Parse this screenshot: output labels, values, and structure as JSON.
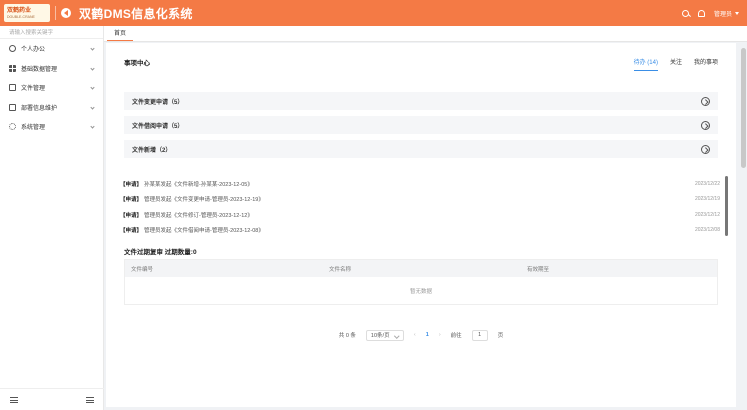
{
  "header": {
    "logo_line1": "双鹤药业",
    "logo_line2": "DOUBLE-CRANE",
    "title": "双鹤DMS信息化系统",
    "user": "管理员"
  },
  "sidebar": {
    "search_placeholder": "请输入搜索关键字",
    "items": [
      {
        "label": "个人办公",
        "icon": "person-icon"
      },
      {
        "label": "基础数据管理",
        "icon": "grid-icon"
      },
      {
        "label": "文件管理",
        "icon": "file-icon"
      },
      {
        "label": "部署信息维护",
        "icon": "doc-icon"
      },
      {
        "label": "系统管理",
        "icon": "gear-icon"
      }
    ]
  },
  "tabs": [
    "首页"
  ],
  "todo": {
    "title": "事项中心",
    "subtabs": [
      "待办 (14)",
      "关注",
      "我的事项"
    ],
    "groups": [
      {
        "label": "文件变更申请（5）"
      },
      {
        "label": "文件借阅申请（5）"
      },
      {
        "label": "文件新增（2）"
      }
    ],
    "messages": [
      {
        "tag": "【申请】",
        "text": "孙某某发起《文件新增-孙某某-2023-12-05》",
        "date": "2023/12/22"
      },
      {
        "tag": "【申请】",
        "text": "管理员发起《文件变更申请-管理员-2023-12-19》",
        "date": "2023/12/19"
      },
      {
        "tag": "【申请】",
        "text": "管理员发起《文件修订-管理员-2023-12-12》",
        "date": "2023/12/12"
      },
      {
        "tag": "【申请】",
        "text": "管理员发起《文件借阅申请-管理员-2023-12-08》",
        "date": "2023/12/08"
      }
    ]
  },
  "expire": {
    "title": "文件过期复审 过期数量:0",
    "columns": [
      "文件编号",
      "文件名称",
      "有效期至"
    ],
    "empty_text": "暂无数据"
  },
  "pager": {
    "total": "共 0 条",
    "page_size": "10条/页",
    "prev": "‹",
    "current": "1",
    "next": "›",
    "goto_label": "前往",
    "goto_value": "1",
    "page_suffix": "页"
  }
}
